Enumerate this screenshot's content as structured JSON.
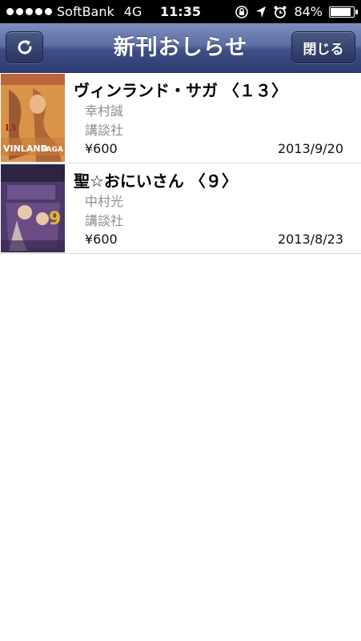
{
  "status_bar": {
    "carrier": "SoftBank",
    "network": "4G",
    "time": "11:35",
    "battery": "84%",
    "icons": [
      "orientation-lock-icon",
      "location-arrow-icon",
      "alarm-icon",
      "battery-icon"
    ]
  },
  "navbar": {
    "title": "新刊おしらせ",
    "refresh_icon": "refresh-icon",
    "close_label": "閉じる"
  },
  "books": [
    {
      "title": "ヴィンランド・サガ 〈１３〉",
      "author": "幸村誠",
      "publisher": "講談社",
      "price": "¥600",
      "date": "2013/9/20",
      "cover_text": "VINLAND SAGA",
      "cover_number": "13",
      "cover_color": "#d68a3c"
    },
    {
      "title": "聖☆おにいさん 〈９〉",
      "author": "中村光",
      "publisher": "講談社",
      "price": "¥600",
      "date": "2013/8/23",
      "cover_number": "9",
      "cover_color": "#5b3d6e"
    }
  ],
  "colors": {
    "nav_top": "#7f8ebc",
    "nav_bottom": "#2d3c72",
    "secondary_text": "#8c8c8c"
  }
}
